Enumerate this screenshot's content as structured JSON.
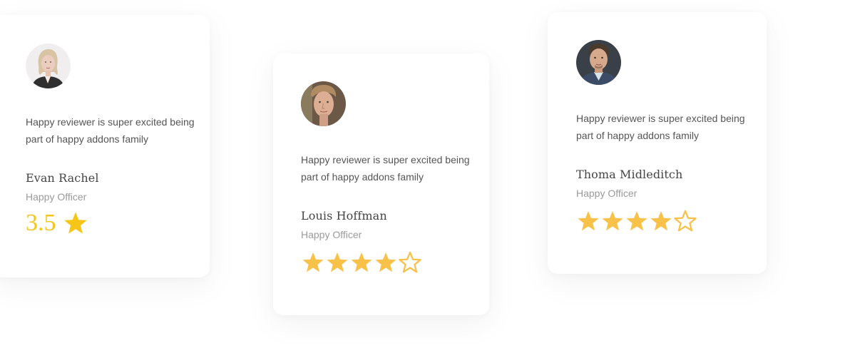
{
  "colors": {
    "star": "#f7c14a",
    "rating_number": "#f5c518",
    "card_bg": "#ffffff"
  },
  "cards": [
    {
      "review": "Happy reviewer is super excited being part of happy addons family",
      "name": "Evan Rachel",
      "role": "Happy Officer",
      "rating": 3.5,
      "rating_display": "3.5",
      "rating_style": "number-with-star"
    },
    {
      "review": "Happy reviewer is super excited being part of happy addons family",
      "name": "Louis Hoffman",
      "role": "Happy Officer",
      "rating": 4,
      "max_rating": 5,
      "rating_style": "stars"
    },
    {
      "review": "Happy reviewer is super excited being part of happy addons family",
      "name": "Thoma Midleditch",
      "role": "Happy Officer",
      "rating": 4,
      "max_rating": 5,
      "rating_style": "stars"
    }
  ]
}
